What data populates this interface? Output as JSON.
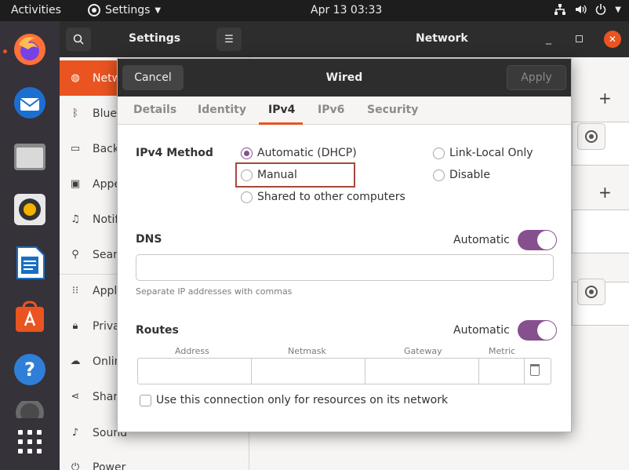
{
  "topbar": {
    "activities": "Activities",
    "app_menu": "Settings",
    "clock": "Apr 13  03:33"
  },
  "dock": {
    "items": [
      "firefox-icon",
      "thunderbird-icon",
      "files-icon",
      "rhythmbox-icon",
      "writer-icon",
      "software-icon",
      "help-icon",
      "trash-icon",
      "apps-grid-icon"
    ]
  },
  "settings": {
    "sidebar_title": "Settings",
    "main_title": "Network",
    "sidebar_items": [
      {
        "label": "Netw",
        "icon": "network-icon"
      },
      {
        "label": "Bluet",
        "icon": "bluetooth-icon"
      },
      {
        "label": "Back",
        "icon": "background-icon"
      },
      {
        "label": "Appe",
        "icon": "appearance-icon"
      },
      {
        "label": "Notif",
        "icon": "notifications-icon"
      },
      {
        "label": "Searc",
        "icon": "search-icon"
      },
      {
        "label": "Appl",
        "icon": "applications-icon"
      },
      {
        "label": "Priva",
        "icon": "privacy-icon"
      },
      {
        "label": "Onlin",
        "icon": "online-accounts-icon"
      },
      {
        "label": "Shari",
        "icon": "sharing-icon"
      },
      {
        "label": "Sound",
        "icon": "sound-icon"
      },
      {
        "label": "Power",
        "icon": "power-icon"
      }
    ]
  },
  "dialog": {
    "cancel_label": "Cancel",
    "title": "Wired",
    "apply_label": "Apply",
    "tabs": [
      "Details",
      "Identity",
      "IPv4",
      "IPv6",
      "Security"
    ],
    "active_tab": "IPv4",
    "ipv4_method_label": "IPv4 Method",
    "methods": {
      "automatic": "Automatic (DHCP)",
      "link_local": "Link-Local Only",
      "manual": "Manual",
      "disable": "Disable",
      "shared": "Shared to other computers"
    },
    "selected_method": "Automatic (DHCP)",
    "dns": {
      "label": "DNS",
      "automatic_label": "Automatic",
      "automatic_on": true,
      "value": "",
      "hint": "Separate IP addresses with commas"
    },
    "routes": {
      "label": "Routes",
      "automatic_label": "Automatic",
      "automatic_on": true,
      "columns": [
        "Address",
        "Netmask",
        "Gateway",
        "Metric"
      ]
    },
    "only_local_label": "Use this connection only for resources on its network",
    "only_local_checked": false
  },
  "colors": {
    "accent": "#e95420",
    "switch_on": "#86508f",
    "highlight_box": "#a8473d"
  }
}
